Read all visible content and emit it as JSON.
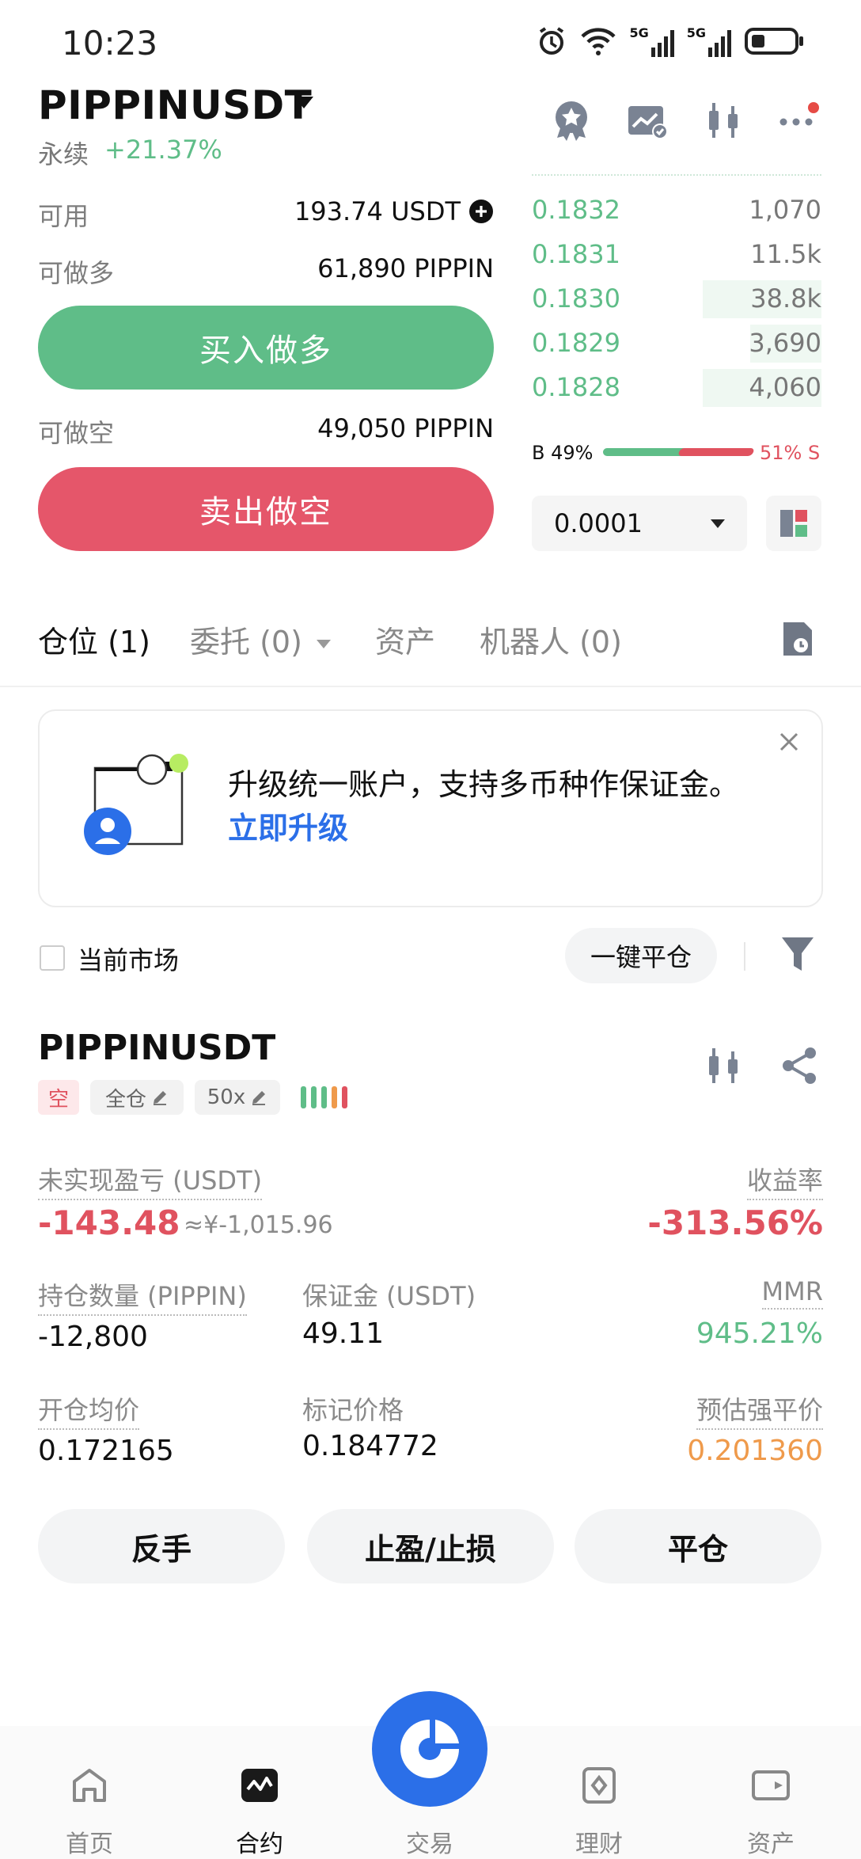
{
  "status_bar": {
    "time": "10:23",
    "signal1": "5G",
    "signal2": "5G"
  },
  "header": {
    "pair": "PIPPINUSDT",
    "type": "永续",
    "change": "+21.37%",
    "icons": [
      "award-icon",
      "chart-check-icon",
      "candlestick-icon",
      "more-icon"
    ]
  },
  "account": {
    "available_label": "可用",
    "available_value": "193.74 USDT",
    "long_label": "可做多",
    "long_value": "61,890 PIPPIN",
    "buy_button": "买入做多",
    "short_label": "可做空",
    "short_value": "49,050 PIPPIN",
    "sell_button": "卖出做空"
  },
  "orderbook": {
    "rows": [
      {
        "price": "0.1832",
        "size": "1,070"
      },
      {
        "price": "0.1831",
        "size": "11.5k"
      },
      {
        "price": "0.1830",
        "size": "38.8k"
      },
      {
        "price": "0.1829",
        "size": "3,690"
      },
      {
        "price": "0.1828",
        "size": "4,060"
      }
    ],
    "buy_ratio": "B 49%",
    "sell_ratio": "51% S",
    "buy_fraction": 0.49,
    "precision": "0.0001"
  },
  "tabs": [
    {
      "label": "仓位 (1)"
    },
    {
      "label": "委托 (0)"
    },
    {
      "label": "资产"
    },
    {
      "label": "机器人 (0)"
    }
  ],
  "promo": {
    "text": "升级统一账户，支持多币种作保证金。",
    "link": "立即升级"
  },
  "filter": {
    "current_market": "当前市场",
    "close_all": "一键平仓"
  },
  "position": {
    "symbol": "PIPPINUSDT",
    "side": "空",
    "margin_mode": "全仓",
    "leverage": "50x",
    "unrealized_label": "未实现盈亏 (USDT)",
    "unrealized_value": "-143.48",
    "unrealized_cny": "≈¥-1,015.96",
    "roe_label": "收益率",
    "roe_value": "-313.56%",
    "qty_label": "持仓数量 (PIPPIN)",
    "qty_value": "-12,800",
    "margin_label": "保证金 (USDT)",
    "margin_value": "49.11",
    "mmr_label": "MMR",
    "mmr_value": "945.21%",
    "entry_label": "开仓均价",
    "entry_value": "0.172165",
    "mark_label": "标记价格",
    "mark_value": "0.184772",
    "liq_label": "预估强平价",
    "liq_value": "0.201360",
    "buttons": [
      "反手",
      "止盈/止损",
      "平仓"
    ]
  },
  "bottom_nav": [
    {
      "label": "首页",
      "icon": "home-icon"
    },
    {
      "label": "合约",
      "icon": "futures-icon"
    },
    {
      "label": "交易",
      "icon": "trade-icon"
    },
    {
      "label": "理财",
      "icon": "earn-icon"
    },
    {
      "label": "资产",
      "icon": "wallet-icon"
    }
  ],
  "colors": {
    "green": "#5fbd88",
    "red": "#e0525f",
    "blue": "#2b6fe8",
    "orange": "#ef9a4b"
  }
}
